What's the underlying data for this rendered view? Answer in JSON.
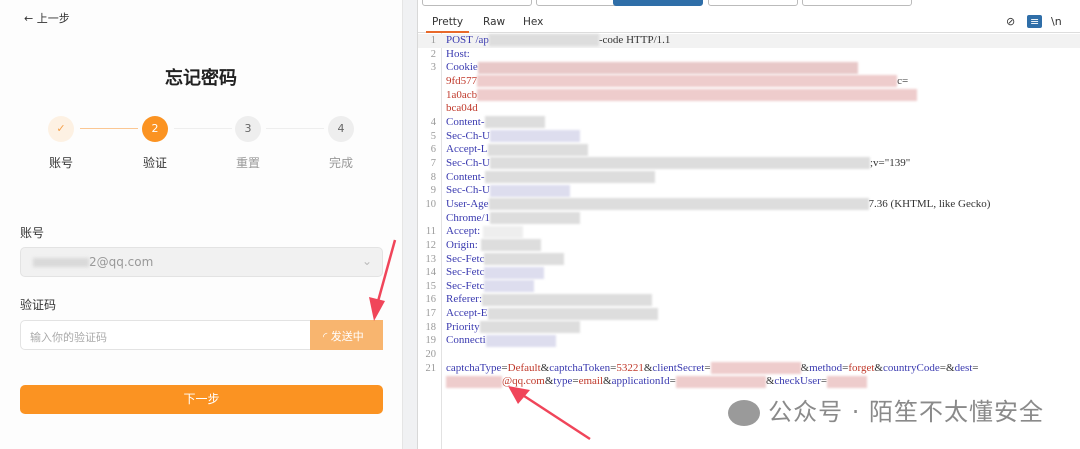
{
  "left": {
    "back_label": "上一步",
    "title": "忘记密码",
    "steps": [
      {
        "num": "✓",
        "label": "账号"
      },
      {
        "num": "2",
        "label": "验证"
      },
      {
        "num": "3",
        "label": "重置"
      },
      {
        "num": "4",
        "label": "完成"
      }
    ],
    "account_label": "账号",
    "account_value": "2@qq.com",
    "code_label": "验证码",
    "code_placeholder": "输入你的验证码",
    "send_label": "发送中",
    "next_label": "下一步"
  },
  "right": {
    "tabs": [
      "Pretty",
      "Raw",
      "Hex"
    ],
    "toolbar_icons": [
      "eye-off-icon",
      "wrap-icon",
      "\\n"
    ],
    "lines": [
      {
        "n": "1",
        "k": "POST /ap",
        "v": "",
        "tail": "-code HTTP/1.1"
      },
      {
        "n": "2",
        "k": "Host:",
        "v": "",
        "tail": ""
      },
      {
        "n": "3",
        "k": "Cookie",
        "v": "",
        "tail": ""
      },
      {
        "n": "",
        "k": "",
        "v": "9fd577",
        "tail": "c="
      },
      {
        "n": "",
        "k": "",
        "v": "1a0acb",
        "tail": ""
      },
      {
        "n": "",
        "k": "",
        "v": "bca04d",
        "tail": ""
      },
      {
        "n": "4",
        "k": "Content-",
        "v": "",
        "tail": ""
      },
      {
        "n": "5",
        "k": "Sec-Ch-U",
        "v": "",
        "tail": ""
      },
      {
        "n": "6",
        "k": "Accept-L",
        "v": "",
        "tail": ""
      },
      {
        "n": "7",
        "k": "Sec-Ch-U",
        "v": "",
        "tail": ";v=\"139\""
      },
      {
        "n": "8",
        "k": "Content-",
        "v": "",
        "tail": ""
      },
      {
        "n": "9",
        "k": "Sec-Ch-U",
        "v": "",
        "tail": ""
      },
      {
        "n": "10",
        "k": "User-Age",
        "v": "",
        "tail": "7.36 (KHTML, like Gecko)"
      },
      {
        "n": "",
        "k": "Chrome/1",
        "v": "",
        "tail": ""
      },
      {
        "n": "11",
        "k": "Accept: ",
        "v": "",
        "tail": ""
      },
      {
        "n": "12",
        "k": "Origin: ",
        "v": "",
        "tail": ""
      },
      {
        "n": "13",
        "k": "Sec-Fetc",
        "v": "",
        "tail": ""
      },
      {
        "n": "14",
        "k": "Sec-Fetc",
        "v": "",
        "tail": ""
      },
      {
        "n": "15",
        "k": "Sec-Fetc",
        "v": "",
        "tail": ""
      },
      {
        "n": "16",
        "k": "Referer:",
        "v": "",
        "tail": ""
      },
      {
        "n": "17",
        "k": "Accept-E",
        "v": "",
        "tail": ""
      },
      {
        "n": "18",
        "k": "Priority",
        "v": "",
        "tail": ""
      },
      {
        "n": "19",
        "k": "Connecti",
        "v": "",
        "tail": ""
      },
      {
        "n": "20",
        "k": "",
        "v": "",
        "tail": ""
      }
    ],
    "body_line_num": "21",
    "body_parts": [
      [
        "captchaType",
        "Default"
      ],
      [
        "captchaToken",
        "53221"
      ],
      [
        "clientSecret",
        ""
      ],
      [
        "method",
        "forget"
      ],
      [
        "countryCode",
        ""
      ],
      [
        "dest",
        ""
      ]
    ],
    "body_cont": [
      [
        "",
        "@qq.com"
      ],
      [
        "type",
        "email"
      ],
      [
        "applicationId",
        ""
      ],
      [
        "checkUser",
        ""
      ]
    ]
  },
  "watermark": "公众号 · 陌笙不太懂安全",
  "colors": {
    "accent": "#fb9322",
    "burp_key": "#3a3ab0",
    "burp_val": "#c0392b",
    "arrow": "#f0455a"
  }
}
